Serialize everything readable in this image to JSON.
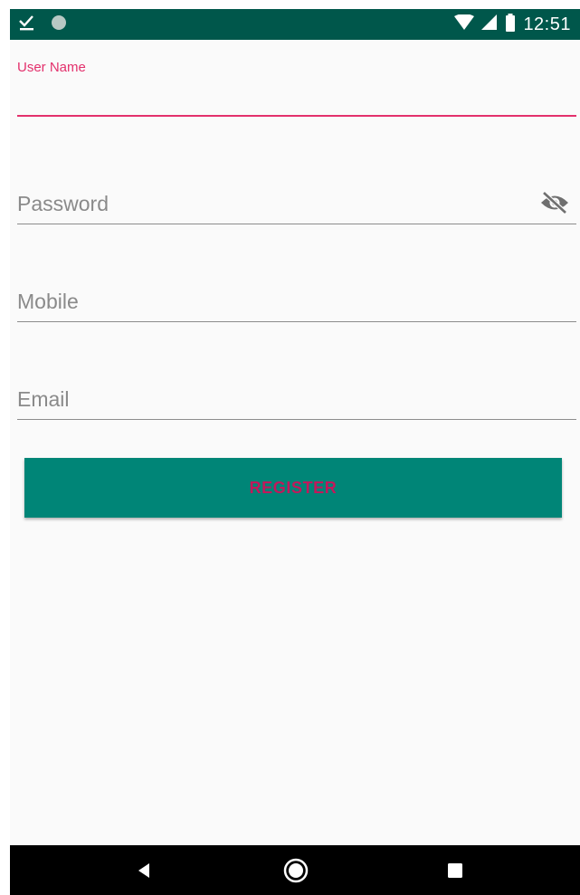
{
  "status_bar": {
    "time": "12:51",
    "icons": [
      "download-done-icon",
      "notification-dot-icon",
      "wifi-icon",
      "cell-signal-icon",
      "battery-icon"
    ]
  },
  "form": {
    "username": {
      "label": "User Name",
      "value": ""
    },
    "password": {
      "placeholder": "Password",
      "toggle_icon": "visibility-off-icon"
    },
    "mobile": {
      "placeholder": "Mobile"
    },
    "email": {
      "placeholder": "Email"
    },
    "register_label": "REGISTER"
  },
  "colors": {
    "status_bar": "#00574b",
    "accent": "#e3306c",
    "button": "#008577",
    "button_text": "#c2185b",
    "background": "#fafafa"
  },
  "nav_bar": {
    "buttons": [
      "back-icon",
      "home-icon",
      "recents-icon"
    ]
  }
}
